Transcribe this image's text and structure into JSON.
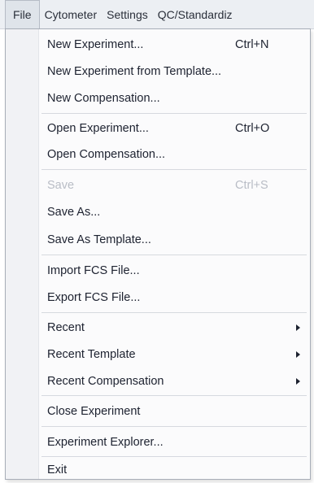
{
  "menubar": {
    "items": [
      {
        "label": "File"
      },
      {
        "label": "Cytometer"
      },
      {
        "label": "Settings"
      },
      {
        "label": "QC/Standardiz"
      }
    ]
  },
  "file_menu": {
    "items": [
      {
        "label": "New Experiment...",
        "shortcut": "Ctrl+N"
      },
      {
        "label": "New Experiment from Template..."
      },
      {
        "label": "New Compensation..."
      },
      {
        "label": "Open Experiment...",
        "shortcut": "Ctrl+O"
      },
      {
        "label": "Open Compensation..."
      },
      {
        "label": "Save",
        "shortcut": "Ctrl+S",
        "disabled": true
      },
      {
        "label": "Save As..."
      },
      {
        "label": "Save As Template..."
      },
      {
        "label": "Import FCS File..."
      },
      {
        "label": "Export FCS File..."
      },
      {
        "label": "Recent",
        "submenu": true
      },
      {
        "label": "Recent Template",
        "submenu": true
      },
      {
        "label": "Recent Compensation",
        "submenu": true
      },
      {
        "label": "Close Experiment"
      },
      {
        "label": "Experiment Explorer..."
      },
      {
        "label": "Exit"
      }
    ]
  }
}
